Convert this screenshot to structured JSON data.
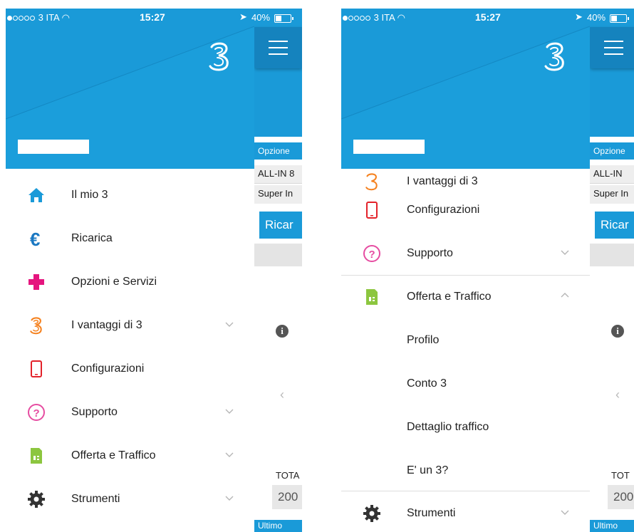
{
  "status_bar": {
    "carrier": "3 ITA",
    "time": "15:27",
    "battery": "40%"
  },
  "background_app": {
    "opzione_label": "Opzione",
    "row1": "ALL-IN 8",
    "row2": "Super In",
    "ricarica_button": "Ricar",
    "totale_label": "TOTA",
    "total_value": "200",
    "ultimo_label": "Ultimo"
  },
  "background_app_right": {
    "opzione_label": "Opzione",
    "row1": "ALL-IN",
    "row2": "Super In",
    "ricarica_button": "Ricar",
    "totale_label": "TOT",
    "total_value": "200",
    "ultimo_label": "Ultimo"
  },
  "left_menu": {
    "items": [
      {
        "label": "Il mio 3",
        "icon": "home-icon"
      },
      {
        "label": "Ricarica",
        "icon": "euro-icon"
      },
      {
        "label": "Opzioni e Servizi",
        "icon": "plus-icon"
      },
      {
        "label": "I vantaggi di 3",
        "icon": "three-logo-icon"
      },
      {
        "label": "Configurazioni",
        "icon": "smartphone-icon"
      },
      {
        "label": "Supporto",
        "icon": "question-icon"
      },
      {
        "label": "Offerta e Traffico",
        "icon": "sim-card-icon"
      },
      {
        "label": "Strumenti",
        "icon": "gear-icon"
      }
    ]
  },
  "right_menu": {
    "partial_item": "I vantaggi di 3",
    "items": [
      {
        "label": "Configurazioni",
        "icon": "smartphone-icon"
      },
      {
        "label": "Supporto",
        "icon": "question-icon"
      },
      {
        "label": "Offerta e Traffico",
        "icon": "sim-card-icon"
      }
    ],
    "sub_items": [
      "Profilo",
      "Conto 3",
      "Dettaglio traffico",
      "E' un 3?"
    ],
    "last_item": {
      "label": "Strumenti",
      "icon": "gear-icon"
    }
  },
  "colors": {
    "brand_blue": "#1a9ad8",
    "home": "#1a9ad8",
    "euro": "#1a78c2",
    "plus": "#e5157e",
    "three": "#f58220",
    "phone": "#e3222a",
    "question": "#e64ca1",
    "sim": "#8cc63f",
    "gear": "#333333"
  }
}
